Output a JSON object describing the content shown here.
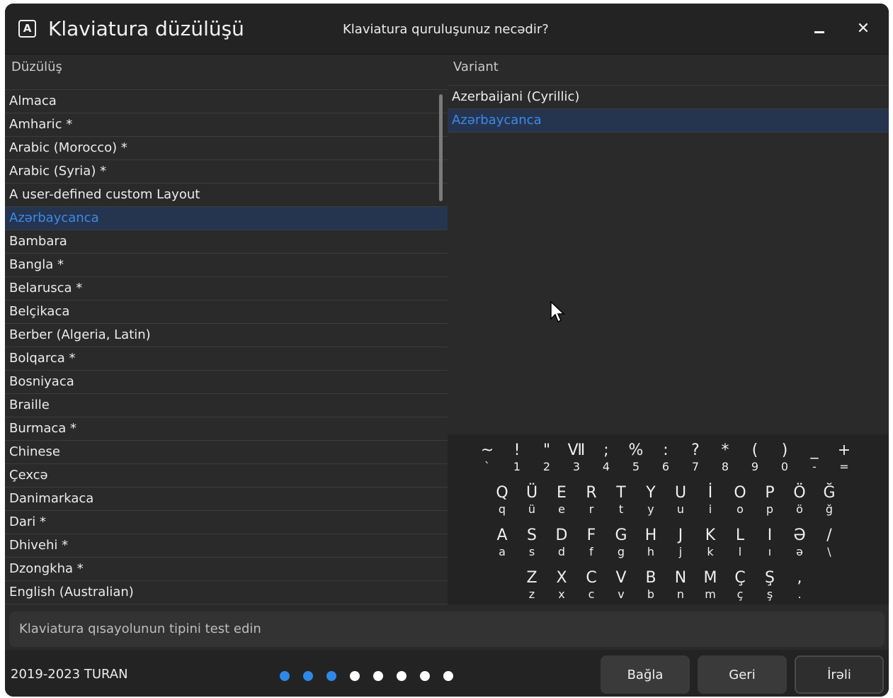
{
  "header": {
    "app_icon_letter": "A",
    "title": "Klaviatura düzülüşü",
    "question": "Klaviatura quruluşunuz necədir?",
    "close_glyph": "✕"
  },
  "columns": {
    "layout_header": "Düzülüş",
    "variant_header": "Variant"
  },
  "layouts": [
    {
      "label": "Almaca",
      "selected": false
    },
    {
      "label": "Amharic *",
      "selected": false
    },
    {
      "label": "Arabic (Morocco) *",
      "selected": false
    },
    {
      "label": "Arabic (Syria) *",
      "selected": false
    },
    {
      "label": "A user-defined custom Layout",
      "selected": false
    },
    {
      "label": "Azərbaycanca",
      "selected": true
    },
    {
      "label": "Bambara",
      "selected": false
    },
    {
      "label": "Bangla *",
      "selected": false
    },
    {
      "label": "Belarusca *",
      "selected": false
    },
    {
      "label": "Belçikaca",
      "selected": false
    },
    {
      "label": "Berber (Algeria, Latin)",
      "selected": false
    },
    {
      "label": "Bolqarca *",
      "selected": false
    },
    {
      "label": "Bosniyaca",
      "selected": false
    },
    {
      "label": "Braille",
      "selected": false
    },
    {
      "label": "Burmaca *",
      "selected": false
    },
    {
      "label": "Chinese",
      "selected": false
    },
    {
      "label": "Çexcə",
      "selected": false
    },
    {
      "label": "Danimarkaca",
      "selected": false
    },
    {
      "label": "Dari *",
      "selected": false
    },
    {
      "label": "Dhivehi *",
      "selected": false
    },
    {
      "label": "Dzongkha *",
      "selected": false
    },
    {
      "label": "English (Australian)",
      "selected": false
    }
  ],
  "variants": [
    {
      "label": "Azerbaijani (Cyrillic)",
      "selected": false
    },
    {
      "label": "Azərbaycanca",
      "selected": true
    }
  ],
  "keyboard": {
    "row1": [
      [
        "~",
        "`"
      ],
      [
        "!",
        "1"
      ],
      [
        "\"",
        "2"
      ],
      [
        "Ⅶ",
        "3"
      ],
      [
        ";",
        "4"
      ],
      [
        "%",
        "5"
      ],
      [
        ":",
        "6"
      ],
      [
        "?",
        "7"
      ],
      [
        "*",
        "8"
      ],
      [
        "(",
        "9"
      ],
      [
        ")",
        "0"
      ],
      [
        "_",
        "-"
      ],
      [
        "+",
        "="
      ]
    ],
    "row2": [
      [
        "Q",
        "q"
      ],
      [
        "Ü",
        "ü"
      ],
      [
        "E",
        "e"
      ],
      [
        "R",
        "r"
      ],
      [
        "T",
        "t"
      ],
      [
        "Y",
        "y"
      ],
      [
        "U",
        "u"
      ],
      [
        "İ",
        "i"
      ],
      [
        "O",
        "o"
      ],
      [
        "P",
        "p"
      ],
      [
        "Ö",
        "ö"
      ],
      [
        "Ğ",
        "ğ"
      ]
    ],
    "row3": [
      [
        "A",
        "a"
      ],
      [
        "S",
        "s"
      ],
      [
        "D",
        "d"
      ],
      [
        "F",
        "f"
      ],
      [
        "G",
        "g"
      ],
      [
        "H",
        "h"
      ],
      [
        "J",
        "j"
      ],
      [
        "K",
        "k"
      ],
      [
        "L",
        "l"
      ],
      [
        "I",
        "ı"
      ],
      [
        "Ə",
        "ə"
      ],
      [
        "/",
        "\\"
      ]
    ],
    "row4": [
      [
        "Z",
        "z"
      ],
      [
        "X",
        "x"
      ],
      [
        "C",
        "c"
      ],
      [
        "V",
        "v"
      ],
      [
        "B",
        "b"
      ],
      [
        "N",
        "n"
      ],
      [
        "M",
        "m"
      ],
      [
        "Ç",
        "ç"
      ],
      [
        "Ş",
        "ş"
      ],
      [
        ",",
        "."
      ]
    ]
  },
  "test_field": {
    "placeholder": "Klaviatura qısayolunun tipini test edin"
  },
  "footer": {
    "copyright": "2019-2023 TURAN",
    "progress_steps": 8,
    "progress_completed": 3,
    "close_label": "Bağla",
    "back_label": "Geri",
    "next_label": "İrəli"
  },
  "colors": {
    "accent": "#3d8ae6",
    "selection_bg": "#253550",
    "window_bg": "#2a2a2a",
    "header_bg": "#232323"
  }
}
